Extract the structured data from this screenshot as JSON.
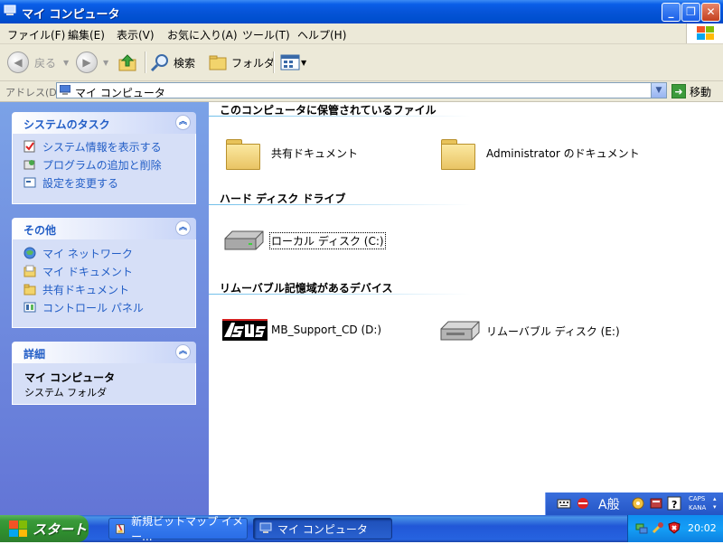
{
  "window": {
    "title": "マイ コンピュータ",
    "minimize_glyph": "_",
    "maximize_glyph": "❐",
    "close_glyph": "✕"
  },
  "menubar": {
    "items": [
      "ファイル(F)",
      "編集(E)",
      "表示(V)",
      "お気に入り(A)",
      "ツール(T)",
      "ヘルプ(H)"
    ]
  },
  "toolbar": {
    "back_label": "戻る",
    "search_label": "検索",
    "folders_label": "フォルダ"
  },
  "addressbar": {
    "label": "アドレス(D)",
    "value": "マイ コンピュータ",
    "go_label": "移動"
  },
  "taskpane": {
    "system_tasks": {
      "title": "システムのタスク",
      "links": [
        "システム情報を表示する",
        "プログラムの追加と削除",
        "設定を変更する"
      ]
    },
    "other_places": {
      "title": "その他",
      "links": [
        "マイ ネットワーク",
        "マイ ドキュメント",
        "共有ドキュメント",
        "コントロール パネル"
      ]
    },
    "details": {
      "title": "詳細",
      "name": "マイ コンピュータ",
      "type": "システム フォルダ"
    }
  },
  "content": {
    "sections": [
      {
        "title": "このコンピュータに保管されているファイル",
        "items": [
          "共有ドキュメント",
          "Administrator のドキュメント"
        ]
      },
      {
        "title": "ハード ディスク ドライブ",
        "items": [
          "ローカル ディスク (C:)"
        ]
      },
      {
        "title": "リムーバブル記憶域があるデバイス",
        "items": [
          "MB_Support_CD (D:)",
          "リムーバブル ディスク (E:)"
        ]
      }
    ]
  },
  "langbar": {
    "ime_mode": "A般",
    "caps_label": "CAPS",
    "kana_label": "KANA"
  },
  "taskbar": {
    "start_label": "スタート",
    "buttons": [
      {
        "label": "新規ビットマップ イメー...",
        "active": false
      },
      {
        "label": "マイ コンピュータ",
        "active": true
      }
    ],
    "clock": "20:02"
  },
  "colors": {
    "titlebar": "#0054e3",
    "taskpane_link": "#215dc6",
    "taskbar": "#245edb",
    "start_button": "#3c9a3c"
  }
}
